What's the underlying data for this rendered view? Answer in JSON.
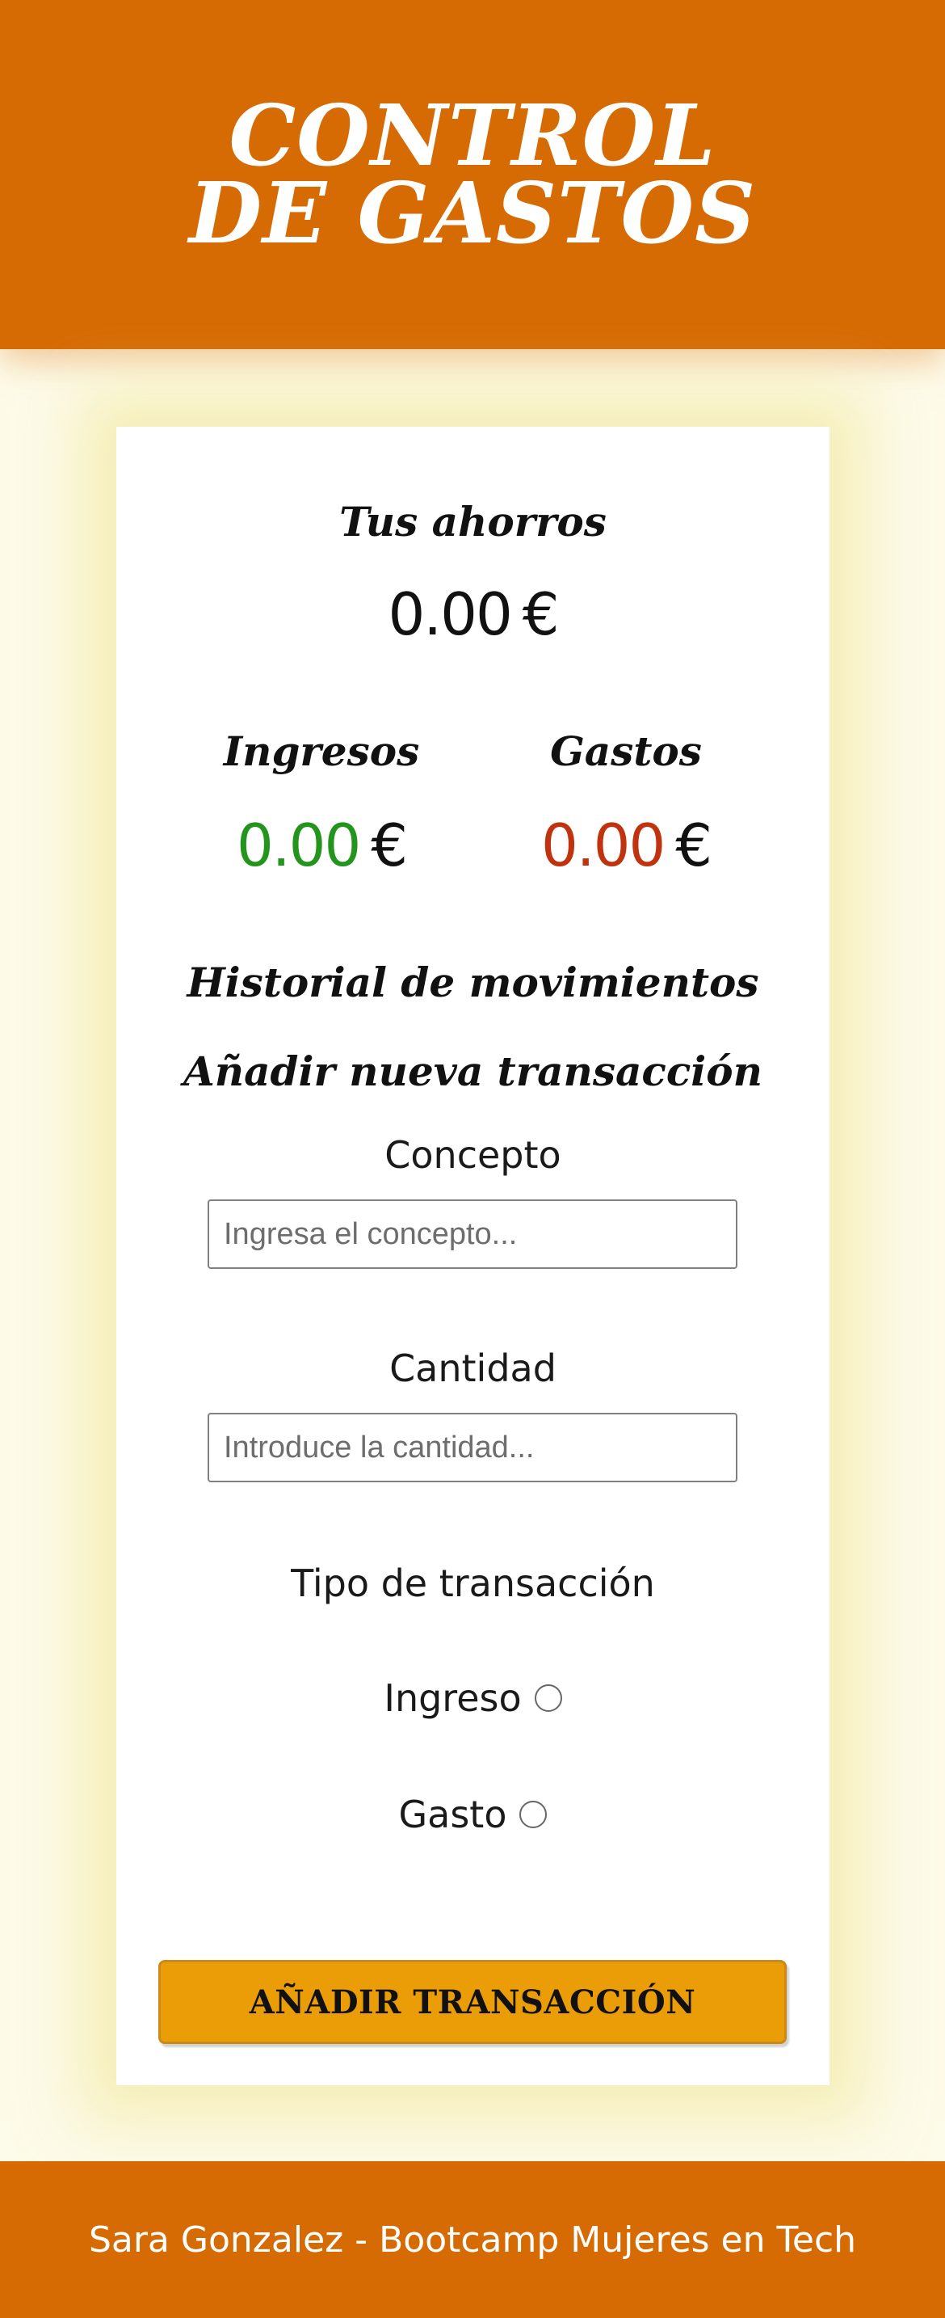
{
  "header": {
    "title": "CONTROL DE GASTOS"
  },
  "savings": {
    "title": "Tus ahorros",
    "value": "0.00",
    "currency": "€"
  },
  "income": {
    "title": "Ingresos",
    "value": "0.00",
    "currency": "€",
    "color": "#23951c"
  },
  "expenses": {
    "title": "Gastos",
    "value": "0.00",
    "currency": "€",
    "color": "#c1330e"
  },
  "history": {
    "title": "Historial de movimientos"
  },
  "form": {
    "title": "Añadir nueva transacción",
    "concept_label": "Concepto",
    "concept_placeholder": "Ingresa el concepto...",
    "amount_label": "Cantidad",
    "amount_placeholder": "Introduce la cantidad...",
    "type_label": "Tipo de transacción",
    "income_option": "Ingreso",
    "expense_option": "Gasto",
    "submit_label": "AÑADIR TRANSACCIÓN"
  },
  "footer": {
    "text": "Sara Gonzalez - Bootcamp Mujeres en Tech"
  },
  "colors": {
    "brand": "#d66b04",
    "button": "#eb9d07",
    "background": "#fdfbe9"
  }
}
